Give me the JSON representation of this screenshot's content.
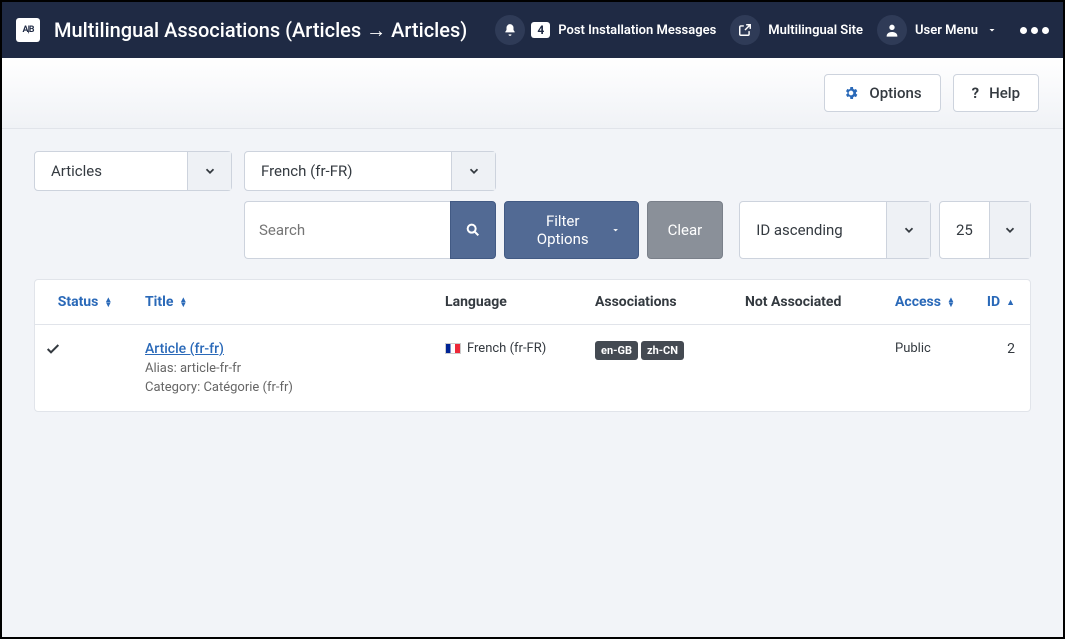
{
  "header": {
    "title": "Multilingual Associations (Articles → Articles)",
    "notif_count": "4",
    "notif_label": "Post Installation Messages",
    "site_label": "Multilingual Site",
    "user_menu_label": "User Menu"
  },
  "toolbar": {
    "options_label": "Options",
    "help_label": "Help"
  },
  "filters": {
    "type_select": "Articles",
    "lang_select": "French (fr-FR)",
    "search_placeholder": "Search",
    "filter_options_label": "Filter Options",
    "clear_label": "Clear",
    "sort_select": "ID ascending",
    "limit_select": "25"
  },
  "columns": {
    "status": "Status",
    "title": "Title",
    "language": "Language",
    "associations": "Associations",
    "not_associated": "Not Associated",
    "access": "Access",
    "id": "ID"
  },
  "rows": [
    {
      "title": "Article (fr-fr)",
      "alias_label": "Alias:",
      "alias": "article-fr-fr",
      "category_label": "Category:",
      "category": "Catégorie (fr-fr)",
      "language": "French (fr-FR)",
      "associations": [
        "en-GB",
        "zh-CN"
      ],
      "access": "Public",
      "id": "2"
    }
  ]
}
